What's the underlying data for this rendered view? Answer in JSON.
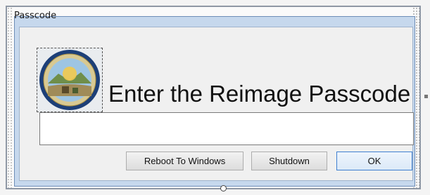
{
  "dialog": {
    "title": "Passcode",
    "heading": "Enter the Reimage Passcode",
    "passcode_value": "",
    "buttons": {
      "reboot": "Reboot To Windows",
      "shutdown": "Shutdown",
      "ok": "OK"
    }
  },
  "logo": {
    "type": "seal",
    "icon": "state-seal-icon"
  },
  "colors": {
    "title_bar": "#c6d8ed",
    "client_background": "#f0f0f0",
    "ok_border": "#3f7fd0"
  }
}
